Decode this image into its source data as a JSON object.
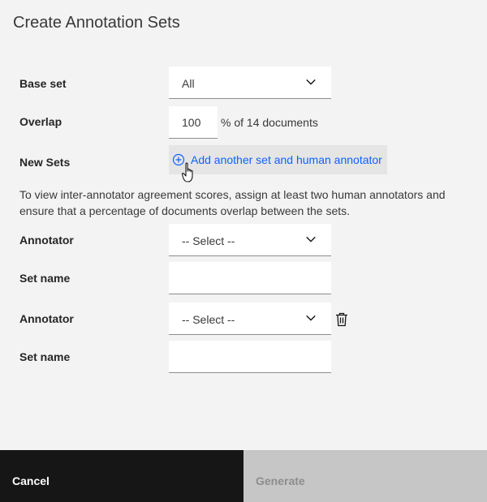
{
  "dialog": {
    "title": "Create Annotation Sets"
  },
  "form": {
    "base_set": {
      "label": "Base set",
      "value": "All"
    },
    "overlap": {
      "label": "Overlap",
      "value": "100",
      "suffix": "% of 14 documents"
    },
    "new_sets": {
      "label": "New Sets",
      "add_button_label": "Add another set and human annotator"
    },
    "helper_text": "To view inter-annotator agreement scores, assign at least two human annotators and ensure that a percentage of documents overlap between the sets.",
    "sets": [
      {
        "annotator_label": "Annotator",
        "annotator_value": "-- Select --",
        "set_name_label": "Set name",
        "set_name_value": ""
      },
      {
        "annotator_label": "Annotator",
        "annotator_value": "-- Select --",
        "set_name_label": "Set name",
        "set_name_value": ""
      }
    ]
  },
  "footer": {
    "cancel_label": "Cancel",
    "generate_label": "Generate"
  },
  "icons": {
    "chevron": "chevron-down-icon",
    "add": "add-circle-icon",
    "trash": "trash-can-icon",
    "cursor": "hand-pointer-cursor-icon"
  },
  "colors": {
    "accent": "#0f62fe",
    "primary_button": "#161616",
    "disabled_button": "#c6c6c6"
  }
}
